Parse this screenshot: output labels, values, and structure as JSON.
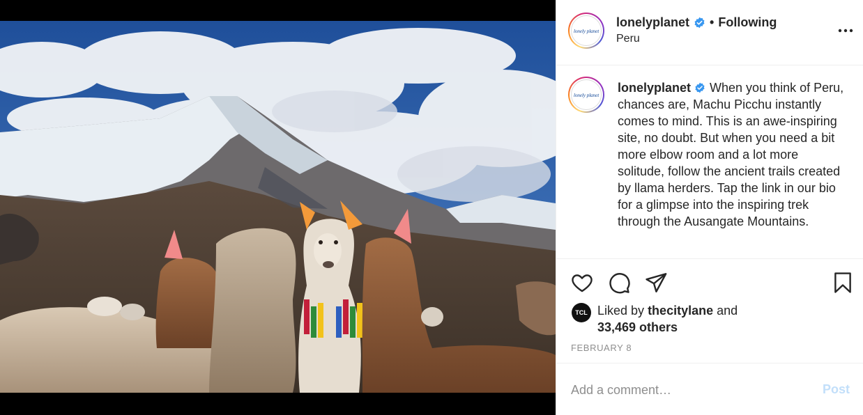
{
  "post": {
    "username": "lonelyplanet",
    "avatar_text": "lonely planet",
    "follow_separator": "•",
    "follow_status": "Following",
    "location": "Peru",
    "more_icon": "more-horizontal-icon",
    "verified_icon": "verified-badge-icon"
  },
  "caption": {
    "username": "lonelyplanet",
    "text": "When you think of Peru, chances are, Machu Picchu instantly comes to mind. This is an awe-inspiring site, no doubt. But when you need a bit more elbow room and a lot more solitude, follow the ancient trails created by llama herders. Tap the link in our bio for a glimpse into the inspiring trek through the Ausangate Mountains."
  },
  "actions": {
    "like_icon": "heart-icon",
    "comment_icon": "comment-icon",
    "share_icon": "send-icon",
    "save_icon": "bookmark-icon"
  },
  "likes": {
    "avatar_text": "TCL",
    "prefix": "Liked by",
    "user": "thecitylane",
    "conjunction": "and",
    "others": "33,469 others"
  },
  "date": "FEBRUARY 8",
  "comment": {
    "placeholder": "Add a comment…",
    "post_label": "Post"
  },
  "colors": {
    "verified": "#3897f0",
    "post_disabled": "#c2dffa",
    "muted": "#8e8e8e"
  }
}
